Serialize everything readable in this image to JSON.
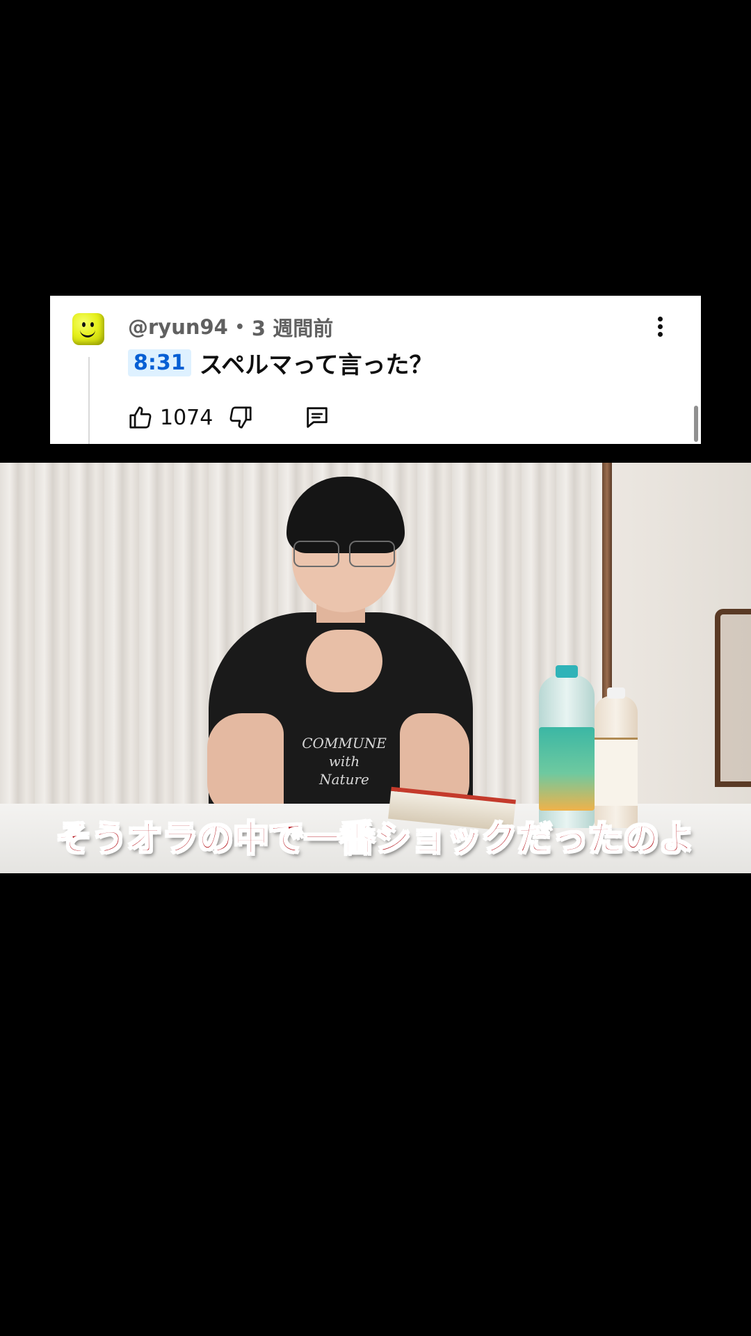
{
  "comment": {
    "author": "@ryun94",
    "separator": "•",
    "posted_time": "3 週間前",
    "timestamp_link": "8:31",
    "text": "スペルマって言った？",
    "like_count": "1074",
    "icons": {
      "avatar": "yellow-smiley-avatar",
      "more": "more-vert-icon",
      "like": "thumbs-up-icon",
      "dislike": "thumbs-down-icon",
      "reply": "comment-reply-icon"
    }
  },
  "video": {
    "subtitle": "そうオラの中で一番ショックだったのよ",
    "shirt_print": [
      "COMMUNE",
      "with",
      "Nature"
    ]
  },
  "colors": {
    "timestamp_link": "#065fd4",
    "timestamp_bg": "#def1ff",
    "subtitle_text": "#b3121a",
    "background": "#000000"
  }
}
